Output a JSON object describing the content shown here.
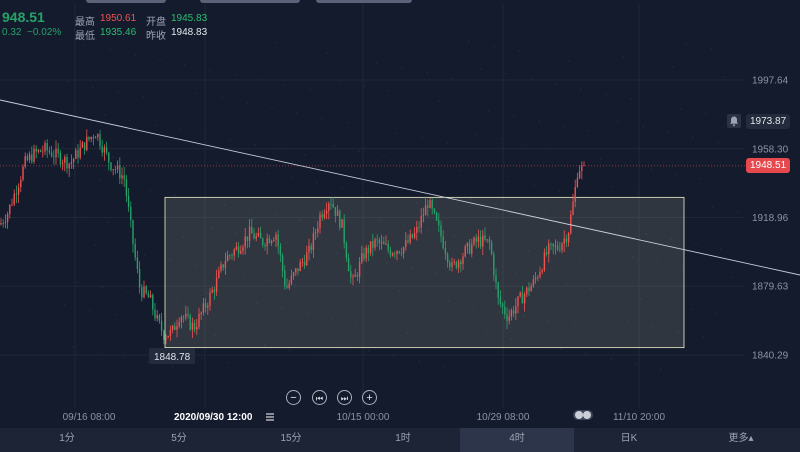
{
  "quote": {
    "last": "948.51",
    "change": "0.32",
    "change_pct": "−0.02%",
    "high_label": "最高",
    "high": "1950.61",
    "low_label": "最低",
    "low": "1935.46",
    "open_label": "开盘",
    "open": "1945.83",
    "prev_close_label": "昨收",
    "prev_close": "1948.83"
  },
  "chart_data": {
    "type": "candlestick",
    "y_ticks": [
      "1997.64",
      "1958.30",
      "1918.96",
      "1879.63",
      "1840.29"
    ],
    "y_tick_values": [
      1997.64,
      1958.3,
      1918.96,
      1879.63,
      1840.29
    ],
    "ylim": [
      1818,
      2030
    ],
    "x_ticks": [
      "09/16 08:00",
      "10/15 00:00",
      "10/29 08:00",
      "11/10 20:00"
    ],
    "crosshair_x_label": "2020/09/30 12:00",
    "crosshair_icon": "menu-icon",
    "current_price": 1948.51,
    "current_price_label": "1948.51",
    "alert_price": 1973.87,
    "alert_price_label": "1973.87",
    "low_marker_label": "1848.78",
    "low_marker_value": 1848.78,
    "range_box": {
      "top": 1930.5,
      "bottom": 1844.5
    },
    "trendline": [
      [
        0,
        1990
      ],
      [
        1,
        1875
      ]
    ],
    "colors": {
      "up": "#ef5350",
      "down": "#26a269",
      "background": "#141b2d",
      "box": "#f0f0c8",
      "trendline": "#c9ced8"
    }
  },
  "controls": {
    "zoom_out_icon": "minus-icon",
    "prev_icon": "step-back-icon",
    "next_icon": "step-forward-icon",
    "zoom_in_icon": "plus-icon",
    "zoom_out": "−",
    "prev": "⏮",
    "next": "⏭",
    "zoom_in": "+"
  },
  "timeframes": [
    {
      "label": "1分"
    },
    {
      "label": "5分"
    },
    {
      "label": "15分"
    },
    {
      "label": "1时"
    },
    {
      "label": "4时",
      "active": true
    },
    {
      "label": "日K"
    },
    {
      "label": "更多▴"
    }
  ]
}
